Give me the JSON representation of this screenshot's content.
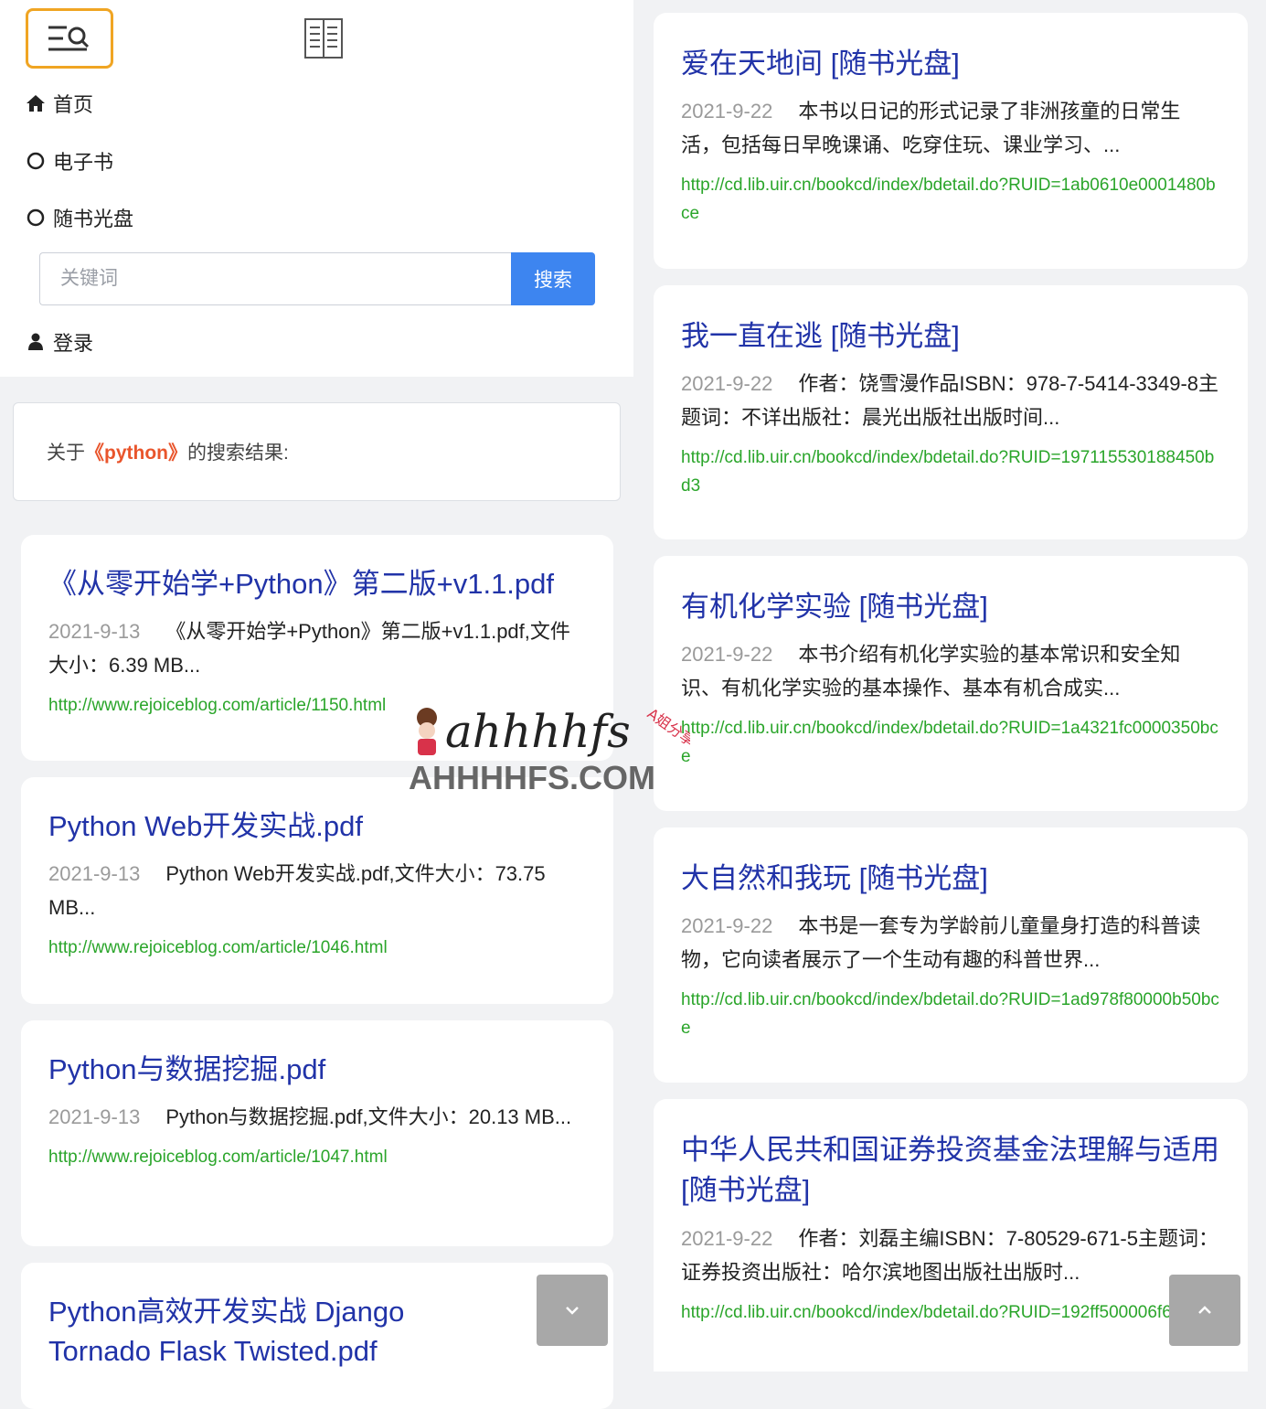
{
  "nav": {
    "home": "首页",
    "ebook": "电子书",
    "cd": "随书光盘",
    "login": "登录",
    "search_placeholder": "关键词",
    "search_button": "搜索"
  },
  "result_header": {
    "prefix": "关于",
    "keyword": "《python》",
    "suffix": "的搜索结果:"
  },
  "left_results": [
    {
      "title": "《从零开始学+Python》第二版+v1.1.pdf",
      "date": "2021-9-13",
      "desc": "《从零开始学+Python》第二版+v1.1.pdf,文件大小：6.39 MB...",
      "url": "http://www.rejoiceblog.com/article/1150.html"
    },
    {
      "title": "Python Web开发实战.pdf",
      "date": "2021-9-13",
      "desc": "Python Web开发实战.pdf,文件大小：73.75 MB...",
      "url": "http://www.rejoiceblog.com/article/1046.html"
    },
    {
      "title": "Python与数据挖掘.pdf",
      "date": "2021-9-13",
      "desc": "Python与数据挖掘.pdf,文件大小：20.13 MB...",
      "url": "http://www.rejoiceblog.com/article/1047.html"
    },
    {
      "title": "Python高效开发实战 Django Tornado Flask Twisted.pdf",
      "date": "",
      "desc": "",
      "url": ""
    }
  ],
  "right_results": [
    {
      "title": "爱在天地间 [随书光盘]",
      "date": "2021-9-22",
      "desc": "本书以日记的形式记录了非洲孩童的日常生活，包括每日早晚课诵、吃穿住玩、课业学习、...",
      "url": "http://cd.lib.uir.cn/bookcd/index/bdetail.do?RUID=1ab0610e0001480bce"
    },
    {
      "title": "我一直在逃 [随书光盘]",
      "date": "2021-9-22",
      "desc": "作者：饶雪漫作品ISBN：978-7-5414-3349-8主题词：不详出版社：晨光出版社出版时间...",
      "url": "http://cd.lib.uir.cn/bookcd/index/bdetail.do?RUID=197115530188450bd3"
    },
    {
      "title": "有机化学实验 [随书光盘]",
      "date": "2021-9-22",
      "desc": "本书介绍有机化学实验的基本常识和安全知识、有机化学实验的基本操作、基本有机合成实...",
      "url": "http://cd.lib.uir.cn/bookcd/index/bdetail.do?RUID=1a4321fc0000350bce"
    },
    {
      "title": "大自然和我玩 [随书光盘]",
      "date": "2021-9-22",
      "desc": "本书是一套专为学龄前儿童量身打造的科普读物，它向读者展示了一个生动有趣的科普世界...",
      "url": "http://cd.lib.uir.cn/bookcd/index/bdetail.do?RUID=1ad978f80000b50bce"
    },
    {
      "title": "中华人民共和国证券投资基金法理解与适用 [随书光盘]",
      "date": "2021-9-22",
      "desc": "作者：刘磊主编ISBN：7-80529-671-5主题词：证券投资出版社：哈尔滨地图出版社出版时...",
      "url": "http://cd.lib.uir.cn/bookcd/index/bdetail.do?RUID=192ff500006f620bd3"
    }
  ],
  "watermark": {
    "script_text": "ahhhhfs",
    "domain_text": "AHHHHFS.COM",
    "tag_text": "A姐分享"
  },
  "colors": {
    "accent_blue": "#3d85f0",
    "title_blue": "#2133a8",
    "link_green": "#2aa52a",
    "keyword_orange": "#e9552c",
    "toggle_border": "#f0a523"
  },
  "icons": {
    "menu_toggle": "menu-search-icon",
    "book": "book-icon",
    "home": "home-icon",
    "radio": "circle-icon",
    "user": "user-icon",
    "scroll_down": "chevron-down-icon",
    "scroll_up": "chevron-up-icon"
  }
}
